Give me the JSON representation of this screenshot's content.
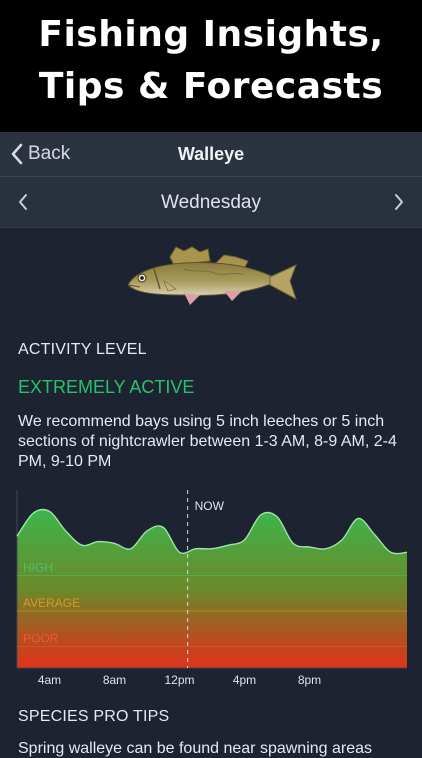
{
  "banner": {
    "line1": "Fishing Insights,",
    "line2": "Tips & Forecasts"
  },
  "nav": {
    "back_label": "Back",
    "title": "Walleye"
  },
  "day": {
    "label": "Wednesday"
  },
  "activity": {
    "section_label": "ACTIVITY LEVEL",
    "status": "EXTREMELY ACTIVE",
    "status_color": "#25c46a",
    "recommendation": "We recommend bays using 5 inch leeches or 5 inch sections of nightcrawler between 1-3 AM, 8-9 AM, 2-4 PM, 9-10 PM"
  },
  "tips": {
    "section_label": "SPECIES PRO TIPS",
    "text": "Spring walleye can be found near spawning areas"
  },
  "chart_data": {
    "type": "area",
    "x_unit": "hour of day",
    "x": [
      0,
      1,
      2,
      3,
      4,
      5,
      6,
      7,
      8,
      9,
      10,
      11,
      12,
      13,
      14,
      15,
      16,
      17,
      18,
      19,
      20,
      21,
      22,
      23,
      24
    ],
    "values": [
      74,
      87,
      88,
      77,
      69,
      71,
      70,
      67,
      77,
      79,
      65,
      67,
      67,
      69,
      72,
      86,
      85,
      70,
      68,
      67,
      72,
      84,
      75,
      65,
      65
    ],
    "level_bands": [
      {
        "label": "HIGH",
        "value": 52,
        "color": "#47c26a"
      },
      {
        "label": "AVERAGE",
        "value": 32,
        "color": "#d99a28"
      },
      {
        "label": "POOR",
        "value": 12,
        "color": "#ec5a2d"
      }
    ],
    "marker": {
      "label": "NOW",
      "x": 10.5
    },
    "x_ticks": [
      {
        "x": 2,
        "label": "4am"
      },
      {
        "x": 6,
        "label": "8am"
      },
      {
        "x": 10,
        "label": "12pm"
      },
      {
        "x": 14,
        "label": "4pm"
      },
      {
        "x": 18,
        "label": "8pm"
      }
    ],
    "ylim": [
      0,
      100
    ]
  }
}
